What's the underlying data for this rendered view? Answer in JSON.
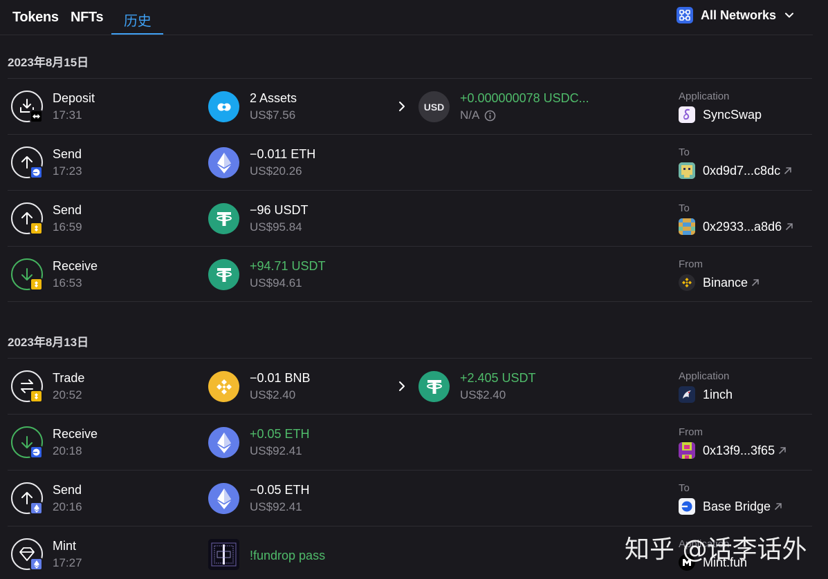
{
  "tabs": {
    "tokens": "Tokens",
    "nfts": "NFTs",
    "history": "历史"
  },
  "network": {
    "label": "All Networks"
  },
  "groups": [
    {
      "date": "2023年8月15日",
      "rows": [
        {
          "type": "Deposit",
          "time": "17:31",
          "amount": "2 Assets",
          "usd": "US$7.56",
          "to_token": "USD",
          "to_amount": "+0.000000078 USDC...",
          "to_usd": "N/A",
          "cp_label": "Application",
          "cp_name": "SyncSwap"
        },
        {
          "type": "Send",
          "time": "17:23",
          "amount": "−0.011 ETH",
          "usd": "US$20.26",
          "cp_label": "To",
          "cp_name": "0xd9d7...c8dc"
        },
        {
          "type": "Send",
          "time": "16:59",
          "amount": "−96 USDT",
          "usd": "US$95.84",
          "cp_label": "To",
          "cp_name": "0x2933...a8d6"
        },
        {
          "type": "Receive",
          "time": "16:53",
          "amount": "+94.71 USDT",
          "usd": "US$94.61",
          "cp_label": "From",
          "cp_name": "Binance"
        }
      ]
    },
    {
      "date": "2023年8月13日",
      "rows": [
        {
          "type": "Trade",
          "time": "20:52",
          "amount": "−0.01 BNB",
          "usd": "US$2.40",
          "to_amount": "+2.405 USDT",
          "to_usd": "US$2.40",
          "cp_label": "Application",
          "cp_name": "1inch"
        },
        {
          "type": "Receive",
          "time": "20:18",
          "amount": "+0.05 ETH",
          "usd": "US$92.41",
          "cp_label": "From",
          "cp_name": "0x13f9...3f65"
        },
        {
          "type": "Send",
          "time": "20:16",
          "amount": "−0.05 ETH",
          "usd": "US$92.41",
          "cp_label": "To",
          "cp_name": "Base Bridge"
        },
        {
          "type": "Mint",
          "time": "17:27",
          "amount": "!fundrop pass",
          "cp_label": "Application",
          "cp_name": "Mint.fun"
        }
      ]
    }
  ],
  "watermark": "知乎 @话李话外",
  "colors": {
    "accent": "#3fa0f3",
    "positive": "#4fbb6a",
    "muted": "#8c8b93",
    "background": "#1a191e"
  }
}
